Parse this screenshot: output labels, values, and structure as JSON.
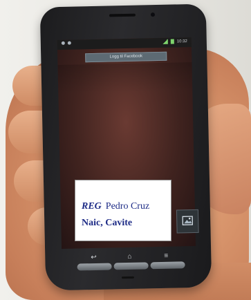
{
  "label": {
    "line1_emphasis": "REG",
    "line1_rest": "Pedro  Cruz",
    "line2": "Naic, Cavite"
  },
  "status": {
    "time": "10:32"
  },
  "notification": {
    "text": "Logg til Facebook"
  },
  "icons": {
    "back": "back-arrow-icon",
    "home": "home-icon",
    "menu": "menu-icon",
    "gallery": "gallery-icon"
  },
  "colors": {
    "label_text": "#1d2b86",
    "phone_body": "#1c1c1e",
    "screen_wallpaper": "#40231f"
  }
}
